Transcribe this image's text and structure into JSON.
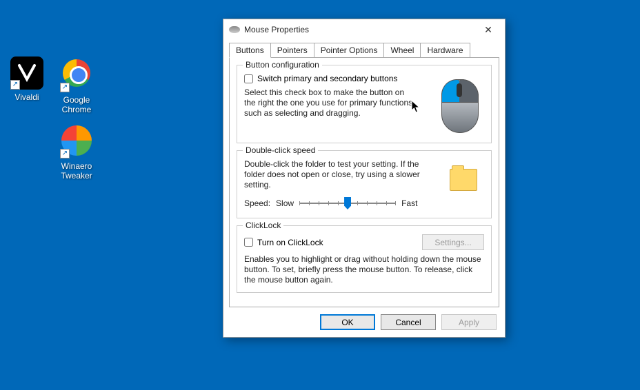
{
  "desktop": {
    "icons": [
      {
        "name": "vivaldi",
        "label": "Vivaldi"
      },
      {
        "name": "chrome",
        "label": "Google Chrome"
      },
      {
        "name": "winaero",
        "label": "Winaero Tweaker"
      }
    ]
  },
  "dialog": {
    "title": "Mouse Properties",
    "tabs": [
      "Buttons",
      "Pointers",
      "Pointer Options",
      "Wheel",
      "Hardware"
    ],
    "active_tab": "Buttons",
    "button_config": {
      "legend": "Button configuration",
      "checkbox_label": "Switch primary and secondary buttons",
      "checkbox_checked": false,
      "desc": "Select this check box to make the button on the right the one you use for primary functions such as selecting and dragging."
    },
    "doubleclick": {
      "legend": "Double-click speed",
      "desc": "Double-click the folder to test your setting. If the folder does not open or close, try using a slower setting.",
      "speed_label": "Speed:",
      "slow_label": "Slow",
      "fast_label": "Fast"
    },
    "clicklock": {
      "legend": "ClickLock",
      "checkbox_label": "Turn on ClickLock",
      "checkbox_checked": false,
      "settings_button": "Settings...",
      "desc": "Enables you to highlight or drag without holding down the mouse button. To set, briefly press the mouse button. To release, click the mouse button again."
    },
    "buttons": {
      "ok": "OK",
      "cancel": "Cancel",
      "apply": "Apply"
    }
  }
}
